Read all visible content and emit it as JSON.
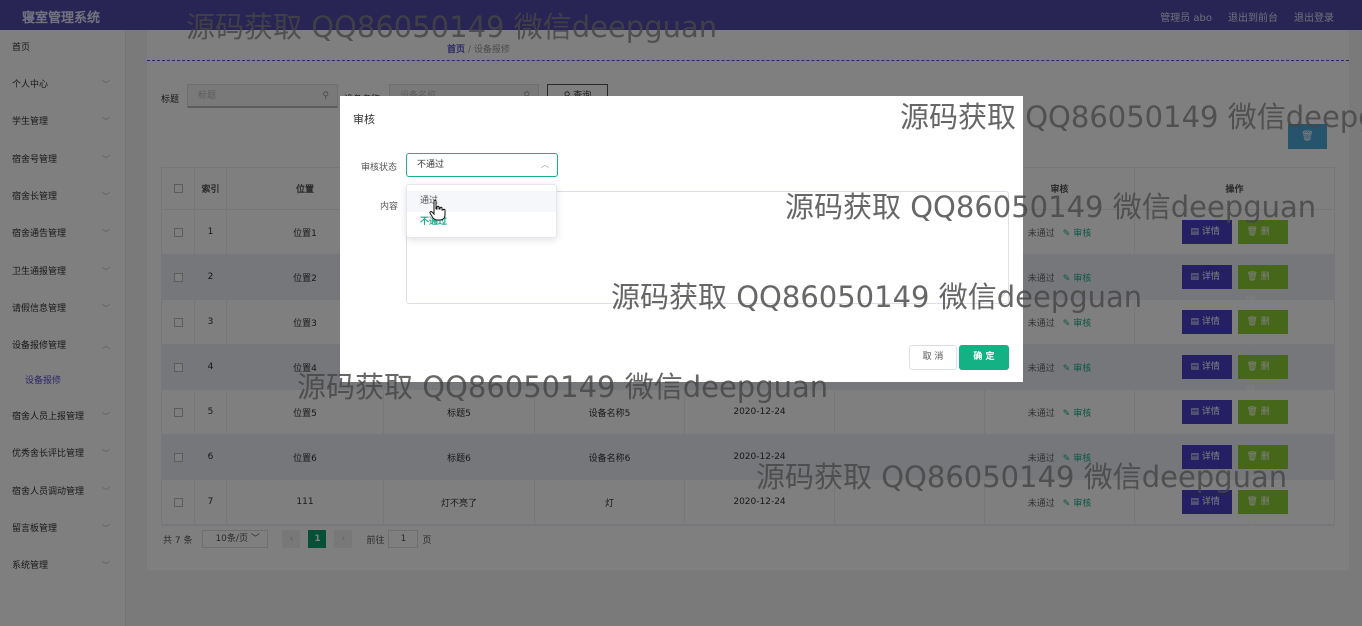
{
  "app": {
    "title": "寝室管理系统"
  },
  "topbar": {
    "user": "管理员 abo",
    "back": "退出到前台",
    "logout": "退出登录"
  },
  "sidebar": {
    "items": [
      {
        "label": "首页",
        "chevron": false
      },
      {
        "label": "个人中心",
        "chevron": true
      },
      {
        "label": "学生管理",
        "chevron": true
      },
      {
        "label": "宿舍号管理",
        "chevron": true
      },
      {
        "label": "宿舍长管理",
        "chevron": true
      },
      {
        "label": "宿舍通告管理",
        "chevron": true
      },
      {
        "label": "卫生通报管理",
        "chevron": true
      },
      {
        "label": "请假信息管理",
        "chevron": true
      },
      {
        "label": "设备报修管理",
        "chevron": true,
        "expanded": true
      },
      {
        "label": "设备报修",
        "sub": true
      },
      {
        "label": "宿舍人员上报管理",
        "chevron": true
      },
      {
        "label": "优秀舍长评比管理",
        "chevron": true
      },
      {
        "label": "宿舍人员调动管理",
        "chevron": true
      },
      {
        "label": "留言板管理",
        "chevron": true
      },
      {
        "label": "系统管理",
        "chevron": true
      }
    ]
  },
  "breadcrumb": {
    "home": "首页",
    "sep": "/",
    "current": "设备报修"
  },
  "search": {
    "title_label": "标题",
    "title_placeholder": "标题",
    "device_label": "设备名称",
    "device_placeholder": "设备名称",
    "query_label": "查询"
  },
  "table": {
    "headers": [
      "索引",
      "位置",
      "审核",
      "操作"
    ],
    "rows": [
      {
        "index": "1",
        "location": "位置1",
        "title": "",
        "device": "",
        "date": "",
        "status": "未通过",
        "audit": "审核"
      },
      {
        "index": "2",
        "location": "位置2",
        "title": "",
        "device": "",
        "date": "",
        "status": "未通过",
        "audit": "审核"
      },
      {
        "index": "3",
        "location": "位置3",
        "title": "",
        "device": "",
        "date": "",
        "status": "未通过",
        "audit": "审核"
      },
      {
        "index": "4",
        "location": "位置4",
        "title": "",
        "device": "",
        "date": "",
        "status": "未通过",
        "audit": "审核"
      },
      {
        "index": "5",
        "location": "位置5",
        "title": "标题5",
        "device": "设备名称5",
        "date": "2020-12-24",
        "status": "未通过",
        "audit": "审核"
      },
      {
        "index": "6",
        "location": "位置6",
        "title": "标题6",
        "device": "设备名称6",
        "date": "2020-12-24",
        "status": "未通过",
        "audit": "审核"
      },
      {
        "index": "7",
        "location": "111",
        "title": "灯不亮了",
        "device": "灯",
        "date": "2020-12-24",
        "status": "未通过",
        "audit": "审核"
      }
    ],
    "detail_label": "详情",
    "delete_label": "删除"
  },
  "pager": {
    "total": "共 7 条",
    "size": "10条/页",
    "current": "1",
    "goto": "前往",
    "goto_value": "1",
    "page_unit": "页"
  },
  "dialog": {
    "title": "审核",
    "status_label": "审核状态",
    "status_value": "不通过",
    "content_label": "内容",
    "cancel": "取 消",
    "ok": "确 定",
    "options": [
      "通过",
      "不通过"
    ]
  },
  "watermark": {
    "text": "源码获取 QQ86050149 微信deepguan"
  },
  "colors": {
    "primary": "#5048a6",
    "accent": "#19b08c",
    "danger_btn": "#8ccc34"
  }
}
